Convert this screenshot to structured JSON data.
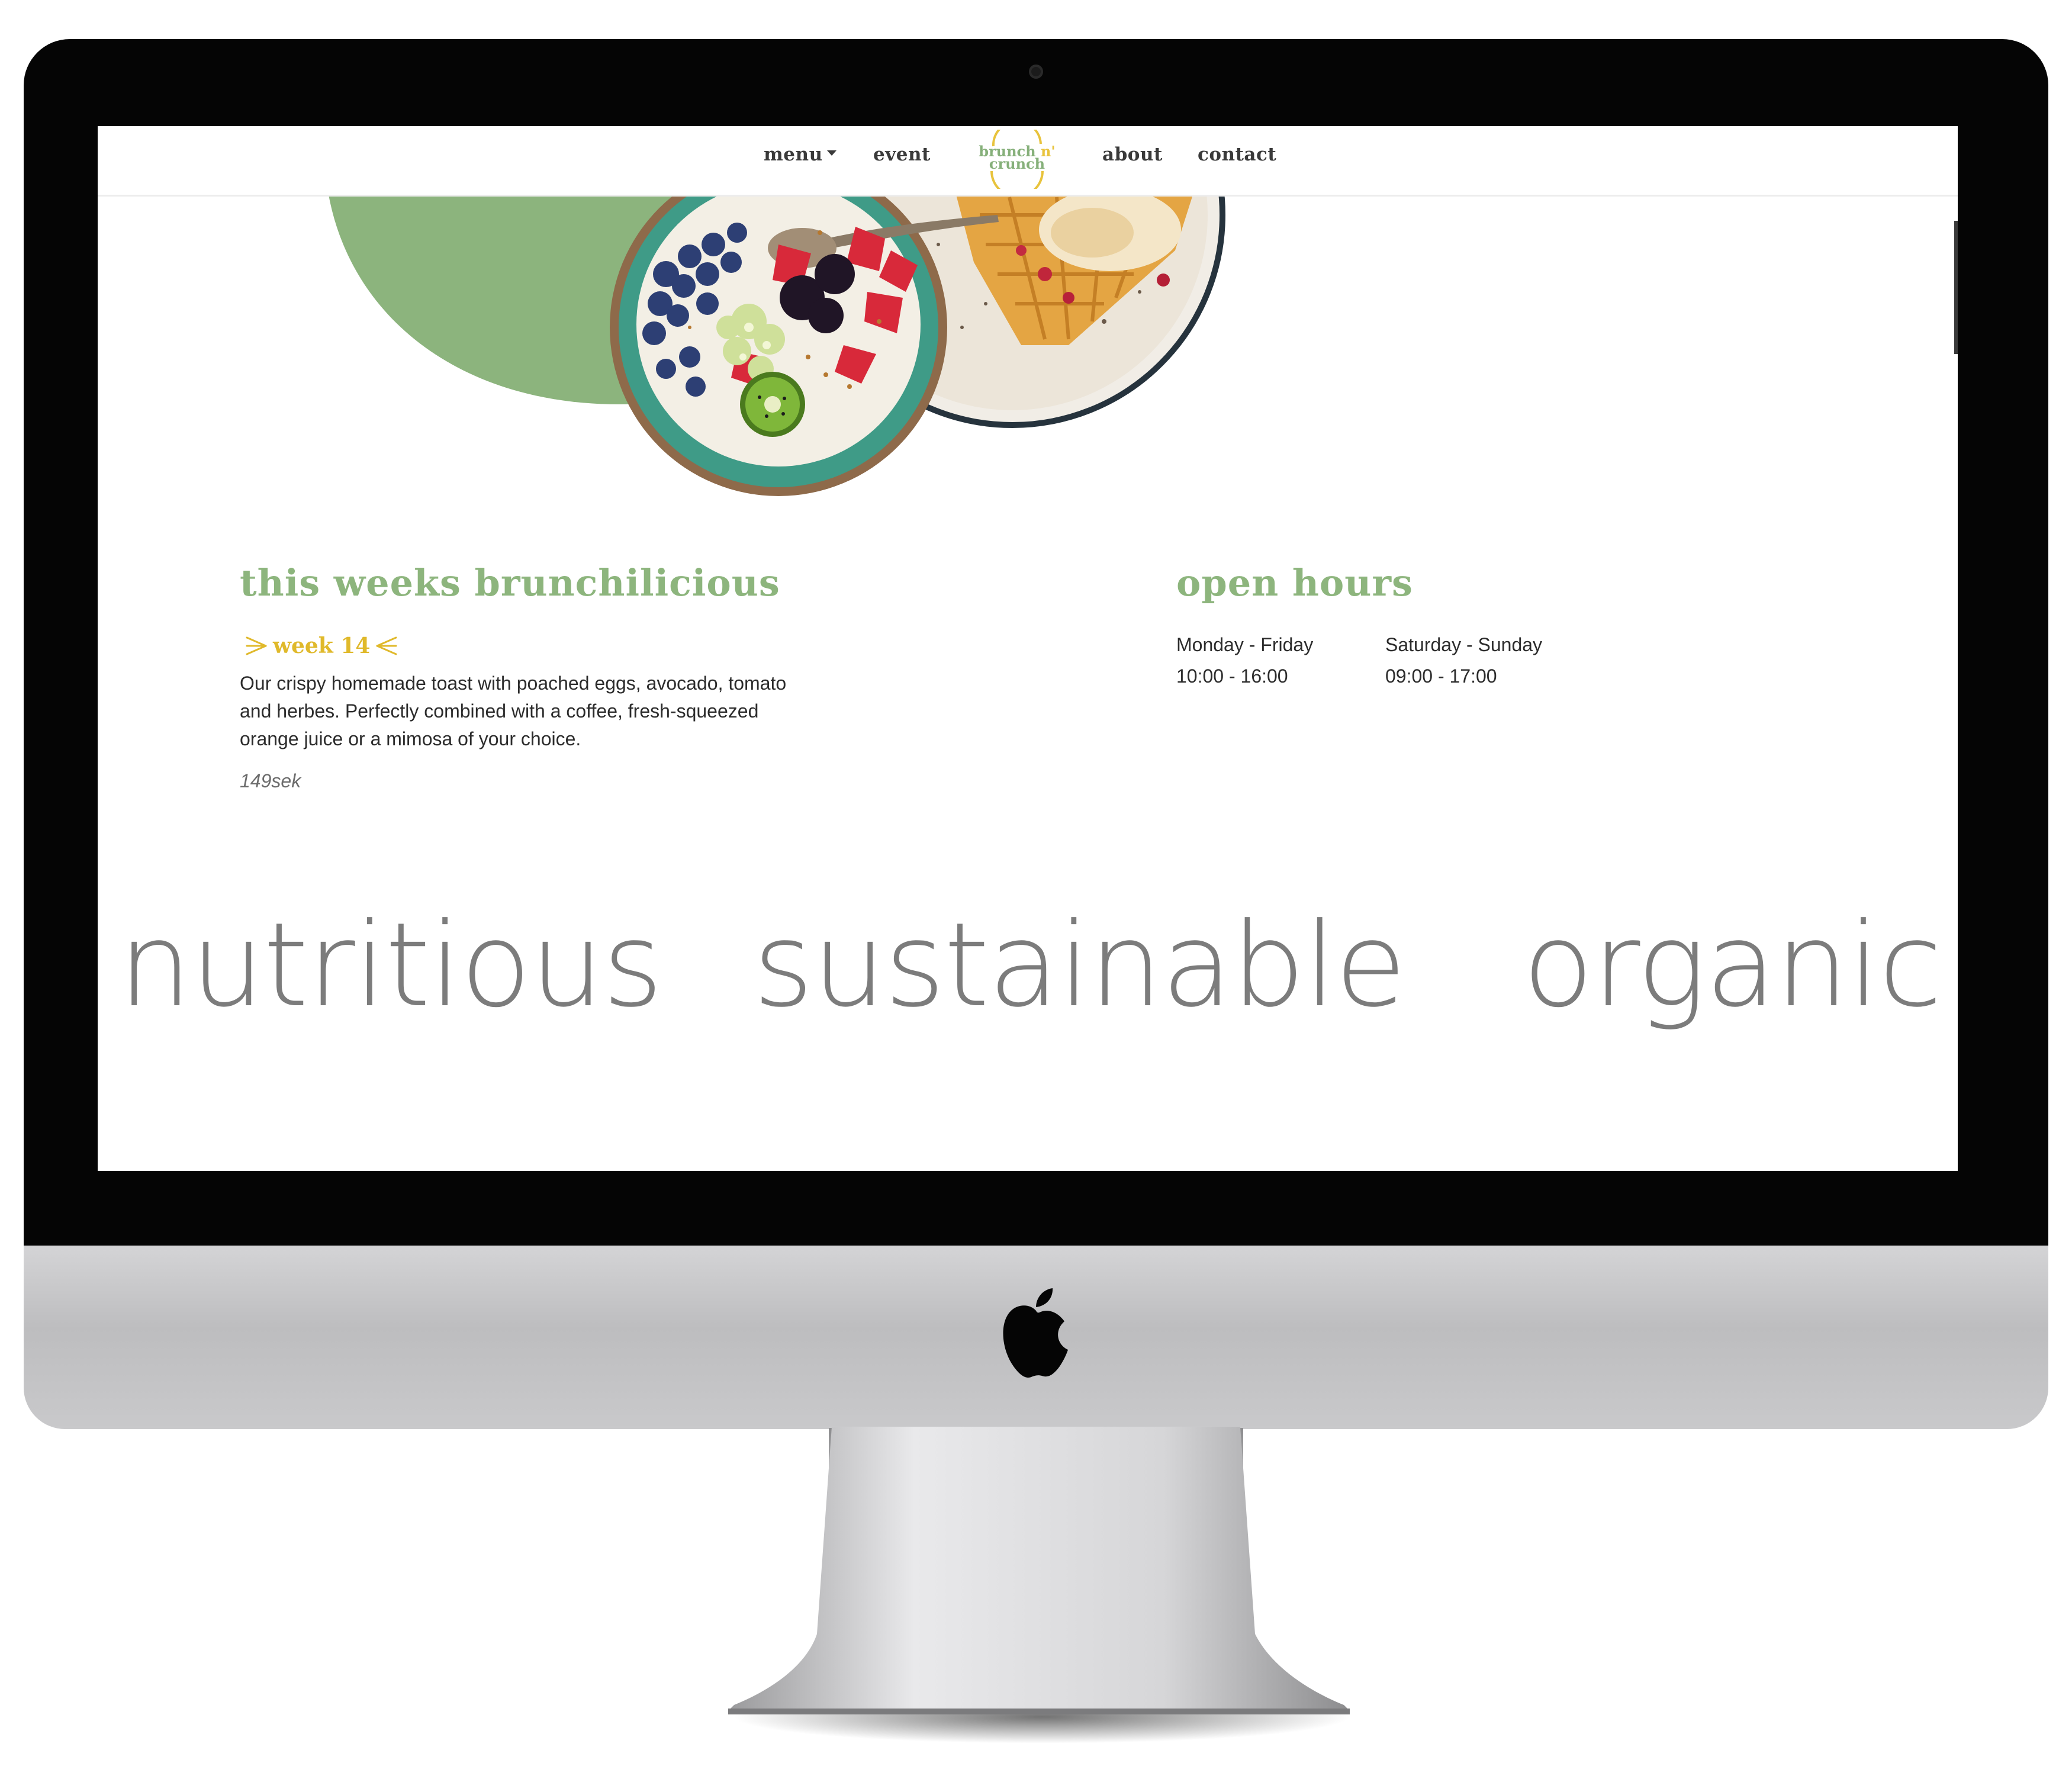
{
  "nav": {
    "menu": "menu",
    "event": "event",
    "about": "about",
    "contact": "contact",
    "logo_line1": "brunch",
    "logo_apostrophe": "n'",
    "logo_line2": "crunch"
  },
  "weekly": {
    "title": "this weeks brunchilicious",
    "week": "week 14",
    "description": "Our crispy homemade toast with poached eggs, avocado, tomato and herbes. Perfectly combined with a coffee, fresh-squeezed orange juice or a mimosa of your choice.",
    "price": "149sek"
  },
  "hours": {
    "title": "open hours",
    "weekdays_label": "Monday - Friday",
    "weekdays_time": "10:00 - 16:00",
    "weekend_label": "Saturday - Sunday",
    "weekend_time": "09:00 - 17:00"
  },
  "values": [
    "nutritious",
    "sustainable",
    "organic"
  ],
  "colors": {
    "accent_green": "#8db57d",
    "accent_yellow": "#e0b92b",
    "text_dark": "#2c2c2c",
    "text_grey": "#7c7c7c"
  }
}
